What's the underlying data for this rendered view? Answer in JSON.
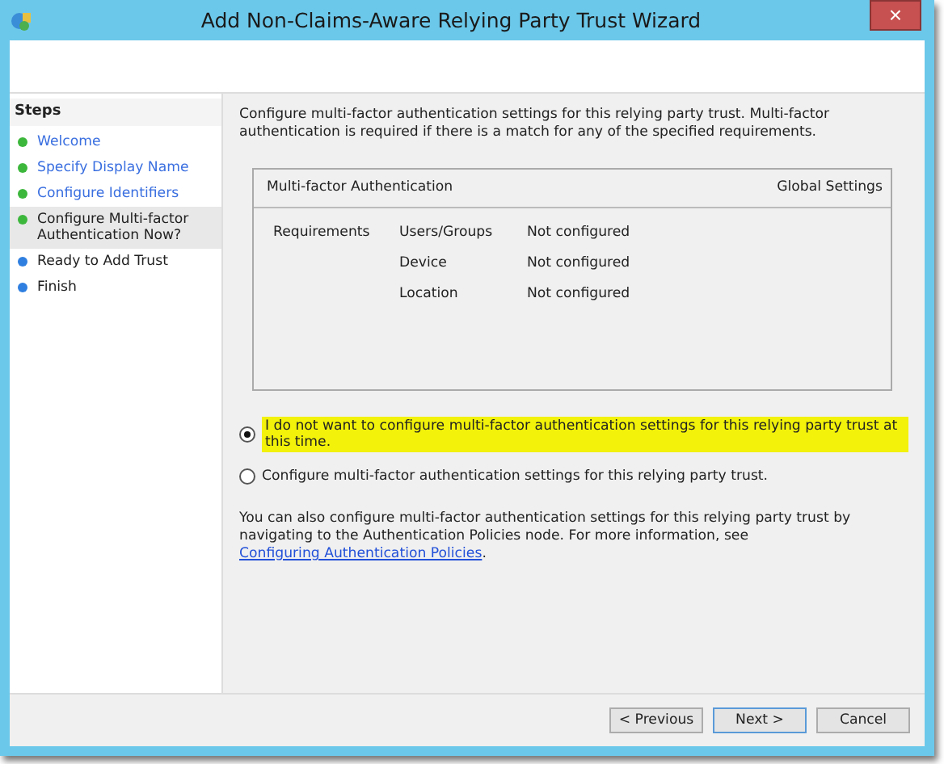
{
  "window": {
    "title": "Add Non-Claims-Aware Relying Party Trust Wizard",
    "close": "×"
  },
  "steps": {
    "heading": "Steps",
    "items": [
      {
        "label": "Welcome",
        "kind": "link",
        "color": "#3cb73c",
        "selected": false
      },
      {
        "label": "Specify Display Name",
        "kind": "link",
        "color": "#3cb73c",
        "selected": false
      },
      {
        "label": "Configure Identifiers",
        "kind": "link",
        "color": "#3cb73c",
        "selected": false
      },
      {
        "label": "Configure Multi-factor Authentication Now?",
        "kind": "plain",
        "color": "#3cb73c",
        "selected": true
      },
      {
        "label": "Ready to Add Trust",
        "kind": "plain",
        "color": "#2f7fe0",
        "selected": false
      },
      {
        "label": "Finish",
        "kind": "plain",
        "color": "#2f7fe0",
        "selected": false
      }
    ]
  },
  "intro": "Configure multi-factor authentication settings for this relying party trust. Multi-factor authentication is required if there is a match for any of the specified requirements.",
  "mfa_panel": {
    "title": "Multi-factor Authentication",
    "scope": "Global Settings",
    "requirements_label": "Requirements",
    "rows": [
      {
        "name": "Users/Groups",
        "value": "Not configured"
      },
      {
        "name": "Device",
        "value": "Not configured"
      },
      {
        "name": "Location",
        "value": "Not configured"
      }
    ]
  },
  "options": [
    {
      "label": "I do not want to configure multi-factor authentication settings for this relying party trust at this time.",
      "selected": true,
      "highlighted": true
    },
    {
      "label": "Configure multi-factor authentication settings for this relying party trust.",
      "selected": false,
      "highlighted": false
    }
  ],
  "note": {
    "text": "You can also configure multi-factor authentication settings for this relying party trust by navigating to the Authentication Policies node. For more information, see ",
    "link": "Configuring Authentication Policies",
    "after": "."
  },
  "buttons": [
    {
      "label": "< Previous",
      "default": false
    },
    {
      "label": "Next >",
      "default": true
    },
    {
      "label": "Cancel",
      "default": false
    }
  ]
}
